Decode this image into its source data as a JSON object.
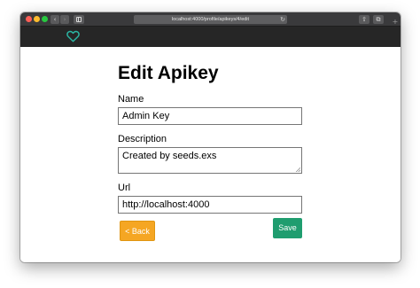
{
  "browser": {
    "address": "localhost:4000/profile/apikeys/4/edit",
    "nav_back_icon": "‹",
    "nav_forward_icon": "›",
    "reload_icon": "↻",
    "share_icon": "⇧",
    "tabs_icon": "⧉",
    "new_tab_icon": "+"
  },
  "app": {
    "logo_color": "#2bb5a3",
    "nav_background": "#262626"
  },
  "form": {
    "title": "Edit Apikey",
    "name_label": "Name",
    "name_value": "Admin Key",
    "description_label": "Description",
    "description_value": "Created by seeds.exs",
    "url_label": "Url",
    "url_value": "http://localhost:4000",
    "back_label": "< Back",
    "save_label": "Save"
  },
  "colors": {
    "back_button": "#f5a623",
    "save_button": "#1f9d6f"
  }
}
